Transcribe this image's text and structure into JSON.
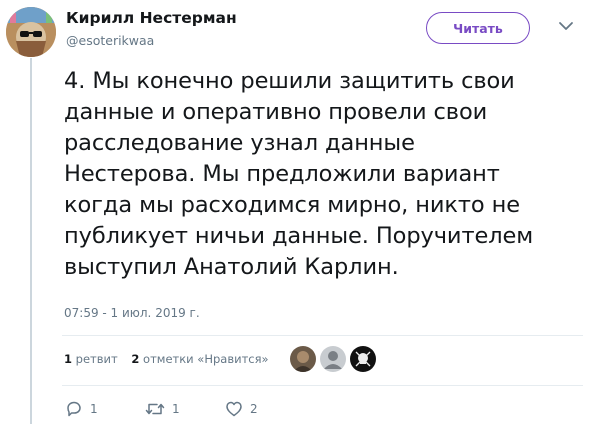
{
  "author": {
    "name": "Кирилл Нестерман",
    "handle": "@esoterikwaa",
    "avatar_icon": "profile-avatar"
  },
  "follow_button": {
    "label": "Читать"
  },
  "menu_icon": "chevron-down-icon",
  "tweet": {
    "text": "4. Мы конечно решили защитить свои\nданные и оперативно провели свои\nрасследование узнал данные\nНестерова. Мы предложили вариант\nкогда мы расходимся мирно, никто не\nпубликует ничьи данные. Поручителем\nвыступил Анатолий Карлин.",
    "timestamp": "07:59 - 1 июл. 2019 г."
  },
  "stats": {
    "retweets_count": "1",
    "retweets_label": "ретвит",
    "likes_count": "2",
    "likes_label": "отметки «Нравится»"
  },
  "likers": [
    "liker-avatar-1",
    "liker-avatar-2",
    "liker-avatar-3"
  ],
  "actions": {
    "reply_count": "1",
    "retweet_count": "1",
    "like_count": "2"
  },
  "colors": {
    "accent": "#794bc4",
    "secondary_text": "#657786",
    "divider": "#e6ecf0"
  }
}
